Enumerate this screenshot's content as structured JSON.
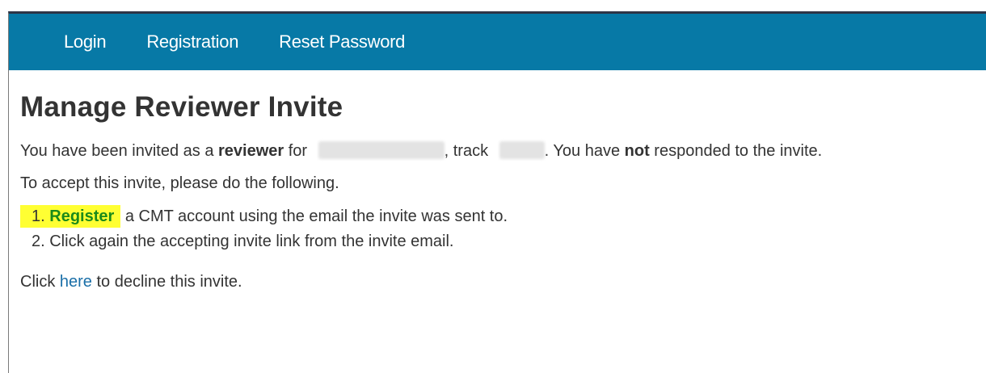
{
  "nav": {
    "login": "Login",
    "registration": "Registration",
    "reset_password": "Reset Password"
  },
  "page": {
    "title": "Manage Reviewer Invite"
  },
  "intro": {
    "part1": "You have been invited as a ",
    "role": "reviewer",
    "part2": " for ",
    "part3": ", track ",
    "part4": ". You have ",
    "not": "not",
    "part5": " responded to the invite."
  },
  "instructions": {
    "accept_text": "To accept this invite, please do the following.",
    "step1_number": "1. ",
    "step1_link": "Register",
    "step1_rest": " a CMT account using the email the invite was sent to.",
    "step2": "2. Click again the accepting invite link from the invite email."
  },
  "decline": {
    "before": "Click ",
    "link": "here",
    "after": " to decline this invite."
  },
  "colors": {
    "navbar": "#0779a6",
    "highlight": "#ffff33",
    "register_link": "#1a8a1a",
    "here_link": "#1a6fa8"
  }
}
